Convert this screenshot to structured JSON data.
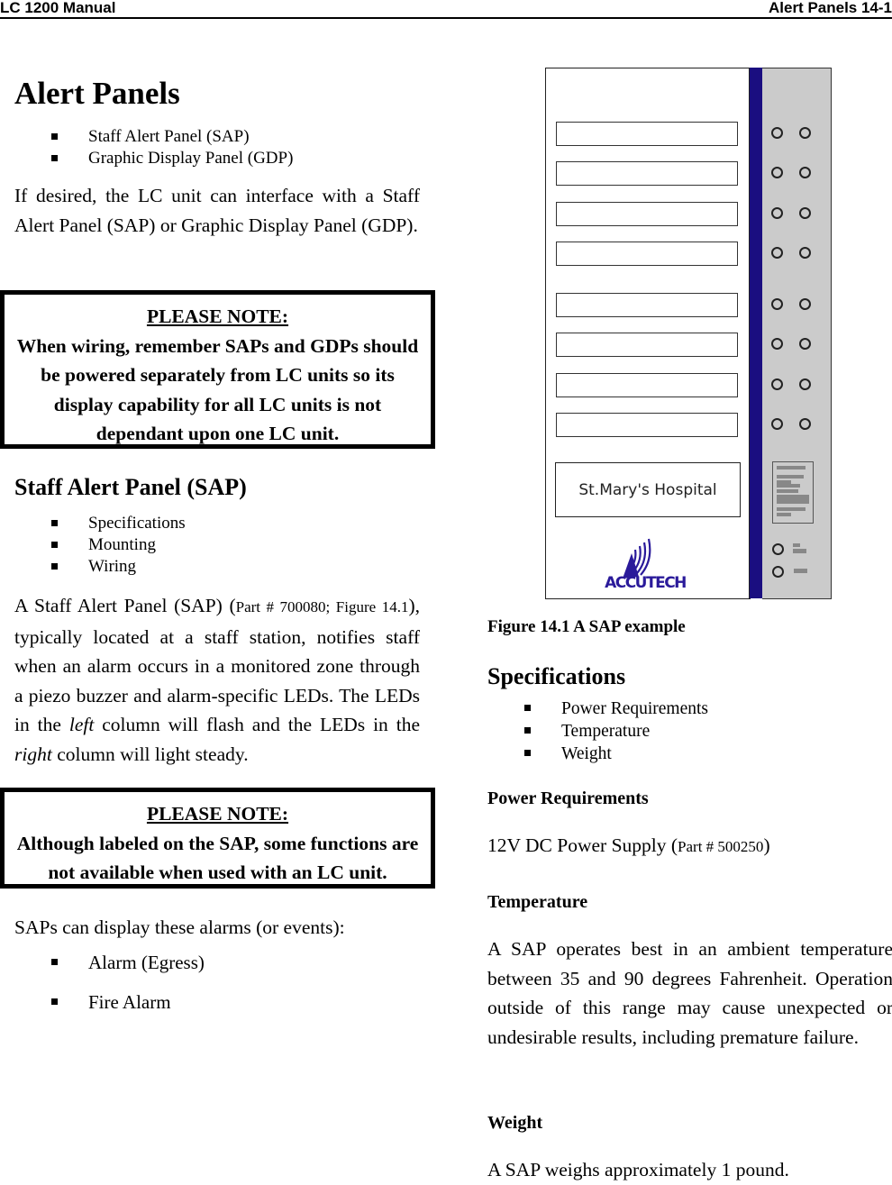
{
  "header": {
    "left": "LC 1200 Manual",
    "right": "Alert Panels 14-1"
  },
  "left_column": {
    "title": "Alert Panels",
    "intro_bullets": [
      "Staff Alert Panel (SAP)",
      "Graphic Display Panel (GDP)"
    ],
    "intro_paragraph": "If desired, the LC unit can interface with a Staff Alert Panel (SAP) or Graphic Display Panel (GDP).",
    "note1": {
      "heading": "PLEASE NOTE:",
      "text": "When wiring, remember SAPs and GDPs should be powered separately from LC units so its display capability for all LC units is not dependant upon one LC unit."
    },
    "sap_heading": "Staff Alert Panel (SAP)",
    "sap_bullets": [
      "Specifications",
      "Mounting",
      "Wiring"
    ],
    "sap_paragraph": {
      "part1": "A Staff Alert Panel (SAP) (",
      "part_ref": "Part # 700080; Figure 14.1",
      "part2": "), typically located at a staff station, notifies staff when an alarm occurs in a monitored zone through a piezo buzzer and alarm-specific LEDs. The LEDs in the ",
      "em1": "left",
      "part3": " column will flash and the LEDs in the ",
      "em2": "right",
      "part4": " column will light steady."
    },
    "note2": {
      "heading": "PLEASE NOTE:",
      "text": "Although labeled on the SAP, some functions are not available when used with an LC unit."
    },
    "alarms_intro": "SAPs can display these alarms (or events):",
    "alarm_bullets": [
      "Alarm (Egress)",
      "Fire Alarm"
    ]
  },
  "figure": {
    "panel_label": "St.Mary's Hospital",
    "logo_text": "ACCUTECH",
    "caption": "Figure 14.1 A SAP example",
    "colors": {
      "stripe": "#1a0e80",
      "side_panel": "#cbcbcb",
      "logo": "#2a1a9a"
    }
  },
  "right_column": {
    "spec_heading": "Specifications",
    "spec_bullets": [
      "Power Requirements",
      "Temperature",
      "Weight"
    ],
    "power_heading": "Power Requirements",
    "power_text": "12V DC Power Supply (",
    "power_part": "Part # 500250",
    "power_close": ")",
    "temp_heading": "Temperature",
    "temp_text": "A SAP operates best in an ambient temperature between 35 and 90 degrees Fahrenheit. Operation outside of this range may cause unexpected or undesirable results, including premature failure.",
    "weight_heading": "Weight",
    "weight_text": "A SAP weighs approximately 1 pound."
  }
}
